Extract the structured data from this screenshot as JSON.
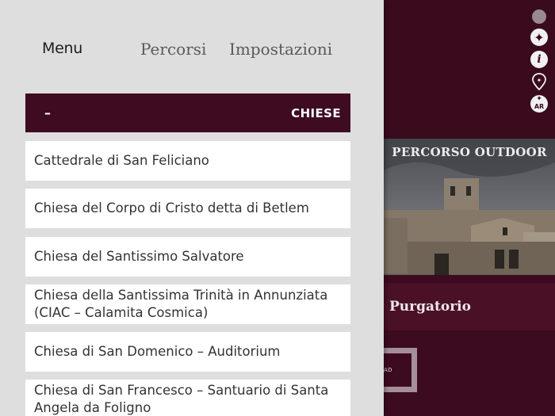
{
  "drawer": {
    "tabs": [
      {
        "label": "Menu",
        "active": true
      },
      {
        "label": "Percorsi",
        "active": false
      },
      {
        "label": "Impostazioni",
        "active": false
      }
    ],
    "category": {
      "toggle": "–",
      "title": "CHIESE"
    },
    "items": [
      "Cattedrale di San Feliciano",
      "Chiesa del Corpo di Cristo detta di Betlem",
      "Chiesa del Santissimo Salvatore",
      "Chiesa della Santissima Trinità in Annunziata (CIAC – Calamita Cosmica)",
      "Chiesa di San Domenico – Auditorium",
      "Chiesa di San Francesco – Santuario di Santa Angela da Foligno"
    ]
  },
  "background": {
    "photo_title": "PERCORSO OUTDOOR",
    "place_name": "Purgatorio",
    "button_label": "AD",
    "side_icons": [
      "circle-icon",
      "plus-icon",
      "info-icon",
      "map-pin-icon",
      "ar-icon"
    ]
  },
  "colors": {
    "brand": "#3e0b20",
    "drawer_bg": "#dedede",
    "item_bg": "#ffffff"
  }
}
